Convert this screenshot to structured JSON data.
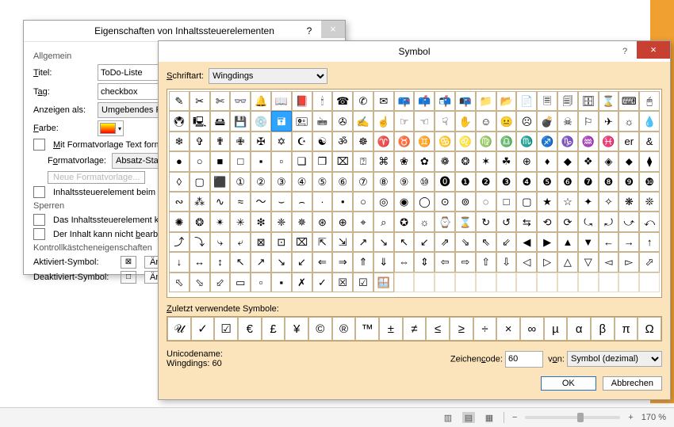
{
  "props": {
    "title": "Eigenschaften von Inhaltssteuerelementen",
    "section_general": "Allgemein",
    "titel_label": "Titel:",
    "titel_value": "ToDo-Liste",
    "tag_label": "Tag:",
    "tag_value": "checkbox",
    "anzeigen_label": "Anzeigen als:",
    "anzeigen_value": "Umgebendes Feld",
    "farbe_label": "Farbe:",
    "chk_formatvorlage": "Mit Formatvorlage Text formatieren",
    "formatvorlage_label": "Formatvorlage:",
    "formatvorlage_value": "Absatz-Standard",
    "neue_fv_btn": "Neue Formatvorlage...",
    "chk_beim_bearb": "Inhaltssteuerelement beim Bearbeiten",
    "section_sperren": "Sperren",
    "chk_kann_nicht": "Das Inhaltssteuerelement kann nicht",
    "chk_inhalt_bearb": "Der Inhalt kann nicht bearbeitet werden",
    "section_kk": "Kontrollkästcheneigenschaften",
    "aktiviert_label": "Aktiviert-Symbol:",
    "deaktiviert_label": "Deaktiviert-Symbol:",
    "aendern_btn": "Ändern..."
  },
  "symbol": {
    "title": "Symbol",
    "schriftart_label": "Schriftart:",
    "schriftart_value": "Wingdings",
    "selected_index": 29,
    "glyphs": [
      "✎",
      "✂",
      "✄",
      "👓",
      "🔔",
      "📖",
      "📕",
      "🕯",
      "☎",
      "✆",
      "✉",
      "📪",
      "📫",
      "📬",
      "📭",
      "📁",
      "📂",
      "📄",
      "🗏",
      "🗐",
      "🗄",
      "⌛",
      "⌨",
      "🖰",
      "🖲",
      "🖳",
      "🖴",
      "💾",
      "💿",
      "🖬",
      "🖭",
      "🖮",
      "✇",
      "✍",
      "☝",
      "☞",
      "☜",
      "☟",
      "✋",
      "☺",
      "😐",
      "☹",
      "💣",
      "☠",
      "⚐",
      "✈",
      "☼",
      "💧",
      "❄",
      "✞",
      "✟",
      "✙",
      "✠",
      "✡",
      "☪",
      "☯",
      "ॐ",
      "☸",
      "♈",
      "♉",
      "♊",
      "♋",
      "♌",
      "♍",
      "♎",
      "♏",
      "♐",
      "♑",
      "♒",
      "♓",
      "er",
      "&",
      "●",
      "○",
      "■",
      "□",
      "▪",
      "▫",
      "❑",
      "❒",
      "⌧",
      "⍰",
      "⌘",
      "❀",
      "✿",
      "❁",
      "❂",
      "✶",
      "☘",
      "⊕",
      "♦",
      "◆",
      "❖",
      "◈",
      "⬥",
      "⧫",
      "◊",
      "▢",
      "⬛",
      "①",
      "②",
      "③",
      "④",
      "⑤",
      "⑥",
      "⑦",
      "⑧",
      "⑨",
      "⑩",
      "⓿",
      "❶",
      "❷",
      "❸",
      "❹",
      "❺",
      "❻",
      "❼",
      "❽",
      "❾",
      "❿",
      "∾",
      "⁂",
      "∿",
      "≈",
      "〜",
      "⌣",
      "⌢",
      "∙",
      "•",
      "○",
      "◎",
      "◉",
      "◯",
      "⊙",
      "⊚",
      "◌",
      "□",
      "▢",
      "★",
      "☆",
      "✦",
      "✧",
      "❋",
      "❊",
      "✺",
      "❂",
      "✴",
      "✳",
      "❇",
      "❈",
      "✵",
      "⊛",
      "⊕",
      "​⌖",
      "⌕",
      "✪",
      "☼",
      "⌚",
      "⌛",
      "↻",
      "↺",
      "⇆",
      "⟲",
      "⟳",
      "⤿",
      "⤾",
      "⤻",
      "⤺",
      "⤴",
      "⤵",
      "⤷",
      "⤶",
      "⊠",
      "⊡",
      "⌧",
      "⇱",
      "⇲",
      "↗",
      "↘",
      "↖",
      "↙",
      "⇗",
      "⇘",
      "⇖",
      "⇙",
      "◀",
      "▶",
      "▲",
      "▼",
      "←",
      "→",
      "↑",
      "↓",
      "↔",
      "↕",
      "↖",
      "↗",
      "↘",
      "↙",
      "⇐",
      "⇒",
      "⇑",
      "⇓",
      "⇔",
      "⇕",
      "⇦",
      "⇨",
      "⇧",
      "⇩",
      "◁",
      "▷",
      "△",
      "▽",
      "◅",
      "▻",
      "⬀",
      "⬁",
      "⬂",
      "⬃",
      "▭",
      "▫",
      "▪",
      "✗",
      "✓",
      "☒",
      "☑",
      "🪟"
    ],
    "total_cells": 240,
    "recent_label": "Zuletzt verwendete Symbole:",
    "recent": [
      "𝒰",
      "✓",
      "☑",
      "€",
      "£",
      "¥",
      "©",
      "®",
      "™",
      "±",
      "≠",
      "≤",
      "≥",
      "÷",
      "×",
      "∞",
      "µ",
      "α",
      "β",
      "π",
      "Ω"
    ],
    "unicodename_label": "Unicodename:",
    "unicodename_value": "Wingdings: 60",
    "zeichencode_label": "Zeichencode:",
    "zeichencode_value": "60",
    "von_label": "von:",
    "von_value": "Symbol (dezimal)",
    "ok": "OK",
    "cancel": "Abbrechen"
  },
  "status": {
    "zoom": "170 %"
  }
}
